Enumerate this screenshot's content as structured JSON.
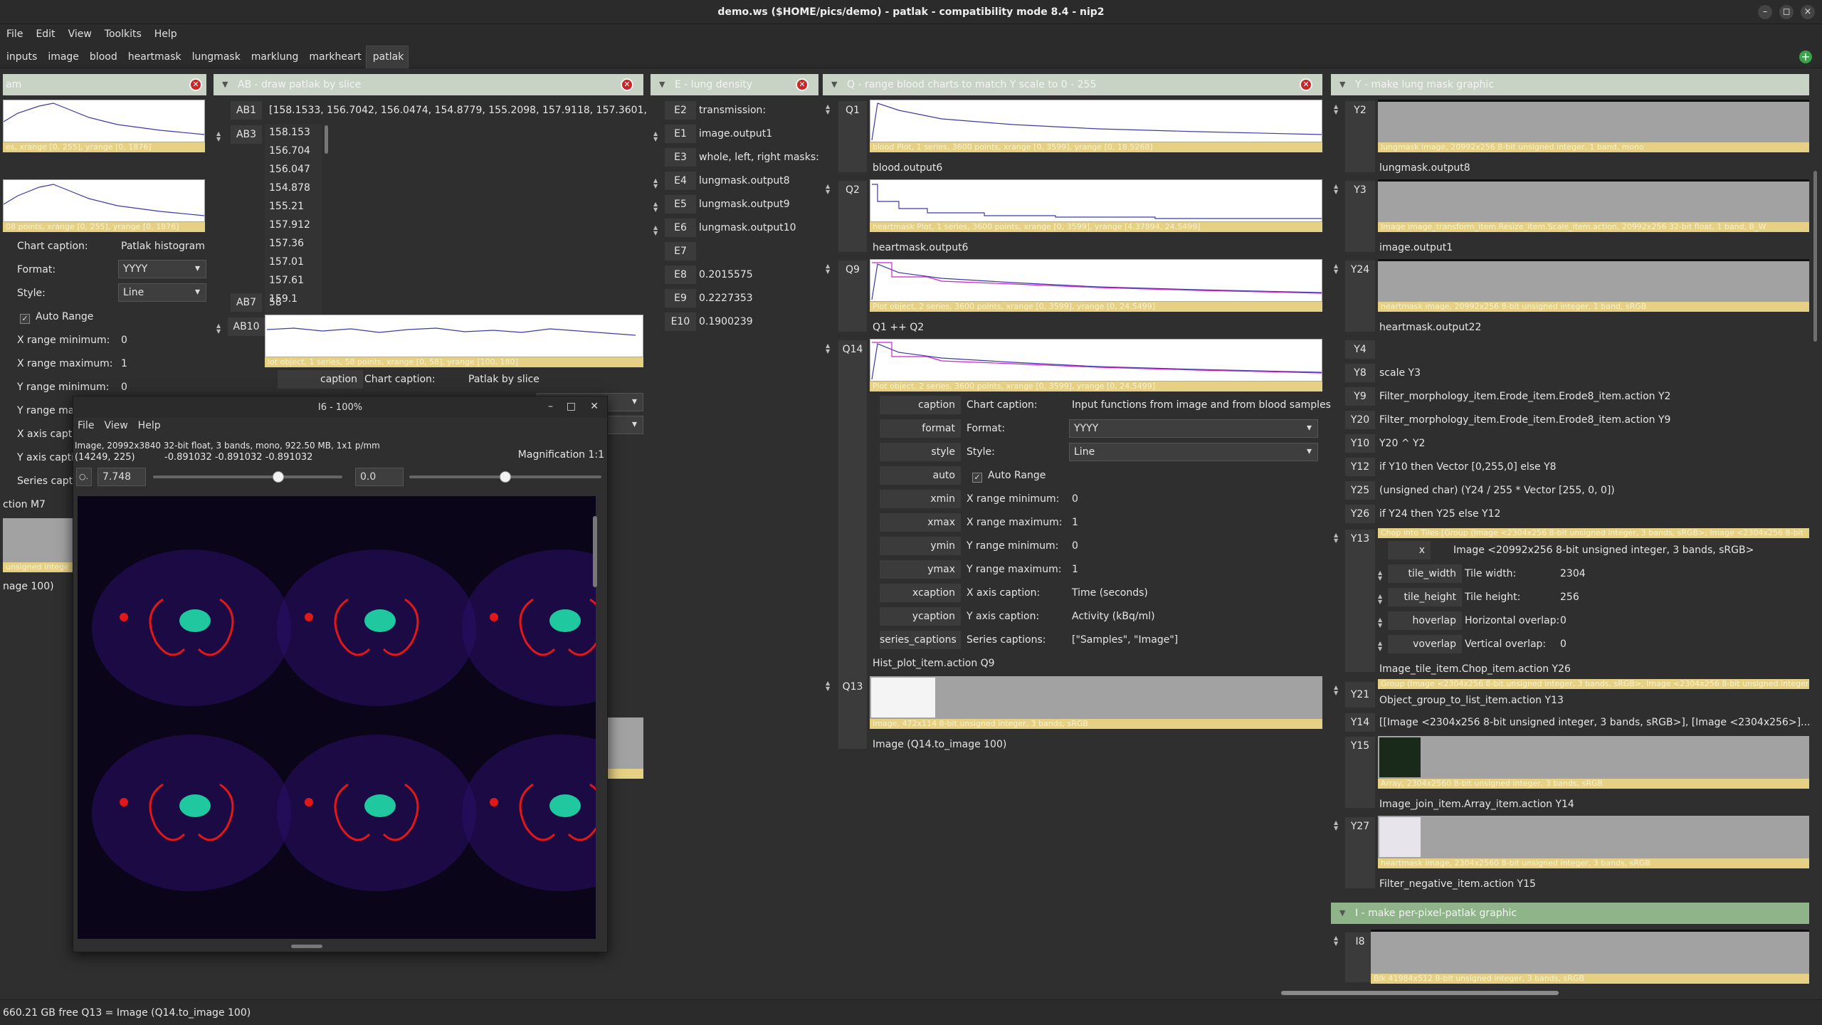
{
  "window": {
    "title": "demo.ws ($HOME/pics/demo) - patlak - compatibility mode 8.4 - nip2",
    "btn_min": "–",
    "btn_max": "◻",
    "btn_close": "×"
  },
  "menu": [
    "File",
    "Edit",
    "View",
    "Toolkits",
    "Help"
  ],
  "tabs": [
    "inputs",
    "image",
    "blood",
    "heartmask",
    "lungmask",
    "marklung",
    "markheart",
    "patlak"
  ],
  "active_tab": "patlak",
  "plus_glyph": "+",
  "colors": {
    "header": "#c8d3c5",
    "caption_bar": "#e6d083",
    "close": "#c62828",
    "plot_blue": "#3a3aa8",
    "plot_magenta": "#d020d0",
    "active_header": "#8fb48a"
  },
  "col_left": {
    "title": "am",
    "cap1": "es, xrange [0, 255], yrange [0, 1876]",
    "cap2": "08 points, xrange [0, 255], yrange [0, 1876]",
    "rows": [
      {
        "k": "Chart caption:",
        "v": "Patlak histogram"
      },
      {
        "k": "Format:",
        "v": "YYYY"
      },
      {
        "k": "Style:",
        "v": "Line"
      },
      {
        "k": "Auto Range",
        "v": ""
      },
      {
        "k": "X range minimum:",
        "v": "0"
      },
      {
        "k": "X range maximum:",
        "v": "1"
      },
      {
        "k": "Y range minimum:",
        "v": "0"
      },
      {
        "k": "Y range max",
        "v": ""
      },
      {
        "k": "X axis captio",
        "v": ""
      },
      {
        "k": "Y axis captio",
        "v": ""
      },
      {
        "k": "Series captio",
        "v": ""
      }
    ],
    "action": "ction M7",
    "cap3": "unsigned intege",
    "img_label": "nage 100)"
  },
  "col_ab": {
    "title": "AB - draw patlak by slice",
    "ab1_label": "AB1",
    "ab1_value": "[158.1533, 156.7042, 156.0474, 154.8779, 155.2098, 157.9118, 157.3601, 157,...",
    "ab3_label": "AB3",
    "ab3_list": [
      "158.153",
      "156.704",
      "156.047",
      "154.878",
      "155.21",
      "157.912",
      "157.36",
      "157.01",
      "157.61",
      "159.1"
    ],
    "ab7_label": "AB7",
    "ab7_value": "58",
    "ab10_label": "AB10",
    "ab10_cap": "lot object, 1 series, 58 points, xrange [0, 58], yrange [100, 180]",
    "ab_caption_key": "caption",
    "ab_caption_label": "Chart caption:",
    "ab_caption_value": "Patlak by slice"
  },
  "col_e": {
    "title": "E - lung density",
    "rows": [
      {
        "k": "E2",
        "v": "transmission:"
      },
      {
        "k": "E1",
        "v": "image.output1"
      },
      {
        "k": "E3",
        "v": "whole, left, right masks:"
      },
      {
        "k": "E4",
        "v": "lungmask.output8"
      },
      {
        "k": "E5",
        "v": "lungmask.output9"
      },
      {
        "k": "E6",
        "v": "lungmask.output10"
      },
      {
        "k": "E7",
        "v": ""
      },
      {
        "k": "E8",
        "v": "0.2015575"
      },
      {
        "k": "E9",
        "v": "0.2227353"
      },
      {
        "k": "E10",
        "v": "0.1900239"
      }
    ]
  },
  "col_q": {
    "title": "Q - range blood charts to match Y scale to 0 - 255",
    "q1": {
      "label": "Q1",
      "cap": "blood Plot, 1 series, 3600 points, xrange [0, 3599], yrange [0, 18.5268]",
      "name": "blood.output6"
    },
    "q2": {
      "label": "Q2",
      "cap": "heartmask Plot, 1 series, 3600 points, xrange [0, 3599], yrange [4.37894, 24.5499]",
      "name": "heartmask.output6"
    },
    "q9": {
      "label": "Q9",
      "cap": "Plot object, 2 series, 3600 points, xrange [0, 3599], yrange [0, 24.5499]",
      "name": "Q1 ++ Q2"
    },
    "q14": {
      "label": "Q14",
      "cap": "Plot object, 2 series, 3600 points, xrange [0, 3599], yrange [0, 24.5499]"
    },
    "params": [
      {
        "key": "caption",
        "k": "Chart caption:",
        "v": "Input functions from image and from blood samples"
      },
      {
        "key": "format",
        "k": "Format:",
        "v": "YYYY"
      },
      {
        "key": "style",
        "k": "Style:",
        "v": "Line"
      },
      {
        "key": "auto",
        "k": "Auto Range",
        "v": ""
      },
      {
        "key": "xmin",
        "k": "X range minimum:",
        "v": "0"
      },
      {
        "key": "xmax",
        "k": "X range maximum:",
        "v": "1"
      },
      {
        "key": "ymin",
        "k": "Y range minimum:",
        "v": "0"
      },
      {
        "key": "ymax",
        "k": "Y range maximum:",
        "v": "1"
      },
      {
        "key": "xcaption",
        "k": "X axis caption:",
        "v": "Time (seconds)"
      },
      {
        "key": "ycaption",
        "k": "Y axis caption:",
        "v": "Activity (kBq/ml)"
      },
      {
        "key": "series_captions",
        "k": "Series captions:",
        "v": "[\"Samples\", \"Image\"]"
      }
    ],
    "q14_action": "Hist_plot_item.action Q9",
    "q13": {
      "label": "Q13",
      "cap": "Image, 472x114 8-bit unsigned integer, 3 bands, sRGB",
      "name": "Image (Q14.to_image 100)"
    }
  },
  "col_y": {
    "title": "Y - make lung mask graphic",
    "y2": {
      "label": "Y2",
      "cap": "lungmask image, 20992x256 8-bit unsigned integer, 1 band, mono",
      "name": "lungmask.output8"
    },
    "y3": {
      "label": "Y3",
      "cap": "Image image_transform_item.Resize_item.Scale_item.action, 20992x256 32-bit float, 1 band, B_W",
      "name": "image.output1"
    },
    "y24": {
      "label": "Y24",
      "cap": "heartmask image, 20992x256 8-bit unsigned integer, 1 band, sRGB",
      "name": "heartmask.output22"
    },
    "rows": [
      {
        "k": "Y4",
        "v": ""
      },
      {
        "k": "Y8",
        "v": "scale Y3"
      },
      {
        "k": "Y9",
        "v": "Filter_morphology_item.Erode_item.Erode8_item.action Y2"
      },
      {
        "k": "Y20",
        "v": "Filter_morphology_item.Erode_item.Erode8_item.action Y9"
      },
      {
        "k": "Y10",
        "v": "Y20 ^ Y2"
      },
      {
        "k": "Y12",
        "v": "if Y10 then Vector [0,255,0] else Y8"
      },
      {
        "k": "Y25",
        "v": "(unsigned char) (Y24 / 255 * Vector [255, 0, 0])"
      },
      {
        "k": "Y26",
        "v": "if Y24 then Y25 else Y12"
      }
    ],
    "y13": {
      "label": "Y13",
      "cap": "Chop into Tiles [Group (Image <2304x256 8-bit unsigned integer, 3 bands, sRGB>, Image <2304x256 8-bit",
      "x_key": "x",
      "x_value": "Image <20992x256 8-bit unsigned integer, 3 bands, sRGB>",
      "params": [
        {
          "key": "tile_width",
          "k": "Tile width:",
          "v": "2304"
        },
        {
          "key": "tile_height",
          "k": "Tile height:",
          "v": "256"
        },
        {
          "key": "hoverlap",
          "k": "Horizontal overlap:",
          "v": "0"
        },
        {
          "key": "voverlap",
          "k": "Vertical overlap:",
          "v": "0"
        }
      ],
      "action": "Image_tile_item.Chop_item.action Y26"
    },
    "y21": {
      "label": "Y21",
      "cap": "Group (Image <2304x256 8-bit unsigned integer, 3 bands, sRGB>, Image <2304x256 8-bit unsigned integer",
      "name": "Object_group_to_list_item.action Y13"
    },
    "y14": {
      "label": "Y14",
      "v": "[[Image <2304x256 8-bit unsigned integer, 3 bands, sRGB>], [Image <2304x256>]..."
    },
    "y15": {
      "label": "Y15",
      "cap": "Array, 2304x2560 8-bit unsigned integer, 3 bands, sRGB",
      "name": "Image_join_item.Array_item.action Y14"
    },
    "y27": {
      "label": "Y27",
      "cap": "heartmask image, 2304x2560 8-bit unsigned integer, 3 bands, sRGB",
      "name": "Filter_negative_item.action Y15"
    }
  },
  "col_i": {
    "title": "I - make per-pixel-patlak graphic",
    "i8": {
      "label": "I8",
      "cap": "Blk 41984x512 8-bit unsigned integer, 3 bands, sRGB"
    }
  },
  "viewer": {
    "title": "I6 - 100%",
    "menu": [
      "File",
      "View",
      "Help"
    ],
    "info": "Image, 20992x3840 32-bit float, 3 bands, mono, 922.50 MB, 1x1 p/mm",
    "coords": "(14249,   225)",
    "pixel": "-0.891032   -0.891032   -0.891032",
    "magnification": "Magnification 1:1",
    "scale": "7.748",
    "offset": "0.0",
    "zoom_icon": "○.",
    "scale_slider": 0.66,
    "offset_slider": 0.5
  },
  "status": {
    "text": "660.21 GB free   Q13 = Image (Q14.to_image 100)"
  }
}
